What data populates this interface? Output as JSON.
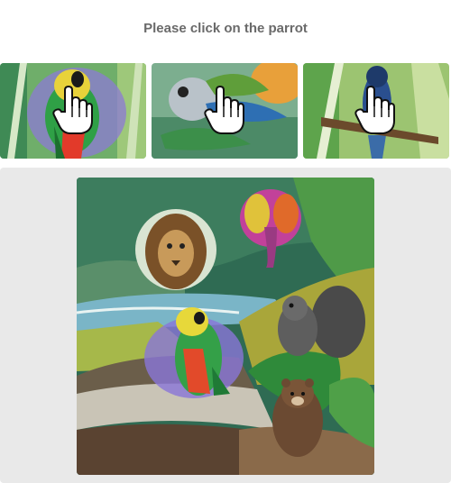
{
  "captcha": {
    "instruction": "Please click on the parrot"
  },
  "examples": [
    {
      "label": "parrot",
      "icon": "hand-pointer-icon"
    },
    {
      "label": "parrot",
      "icon": "hand-pointer-icon"
    },
    {
      "label": "parrot",
      "icon": "hand-pointer-icon"
    }
  ],
  "scene": {
    "animals": [
      "lion",
      "elephant",
      "squirrel",
      "parrot",
      "bear"
    ]
  },
  "colors": {
    "instruction_text": "#6a6a6a",
    "board_background": "#e9e9e9",
    "page_background": "#ffffff"
  }
}
